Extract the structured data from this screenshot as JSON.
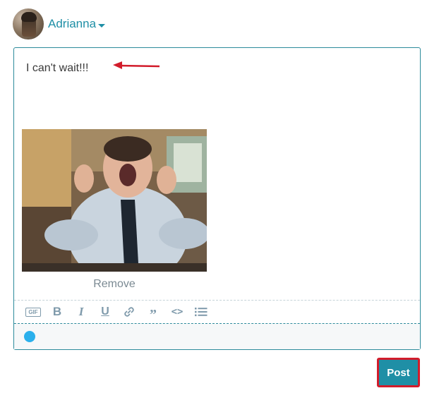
{
  "user": {
    "name": "Adrianna",
    "avatar_icon": "user-avatar"
  },
  "composer": {
    "text": "I can't wait!!!",
    "gif": {
      "action_label": "Remove"
    }
  },
  "toolbar": {
    "items": [
      {
        "icon": "gif-icon",
        "glyph": "GIF"
      },
      {
        "icon": "bold-icon",
        "glyph": "B"
      },
      {
        "icon": "italic-icon",
        "glyph": "I"
      },
      {
        "icon": "underline-icon",
        "glyph": "U"
      },
      {
        "icon": "link-icon",
        "glyph": ""
      },
      {
        "icon": "quote-icon",
        "glyph": "”"
      },
      {
        "icon": "code-icon",
        "glyph": "<>"
      },
      {
        "icon": "list-icon",
        "glyph": ""
      }
    ]
  },
  "actions": {
    "post_label": "Post"
  },
  "colors": {
    "accent": "#1f8fa6",
    "highlight": "#d21c2b",
    "status_dot": "#2bb0ec"
  }
}
